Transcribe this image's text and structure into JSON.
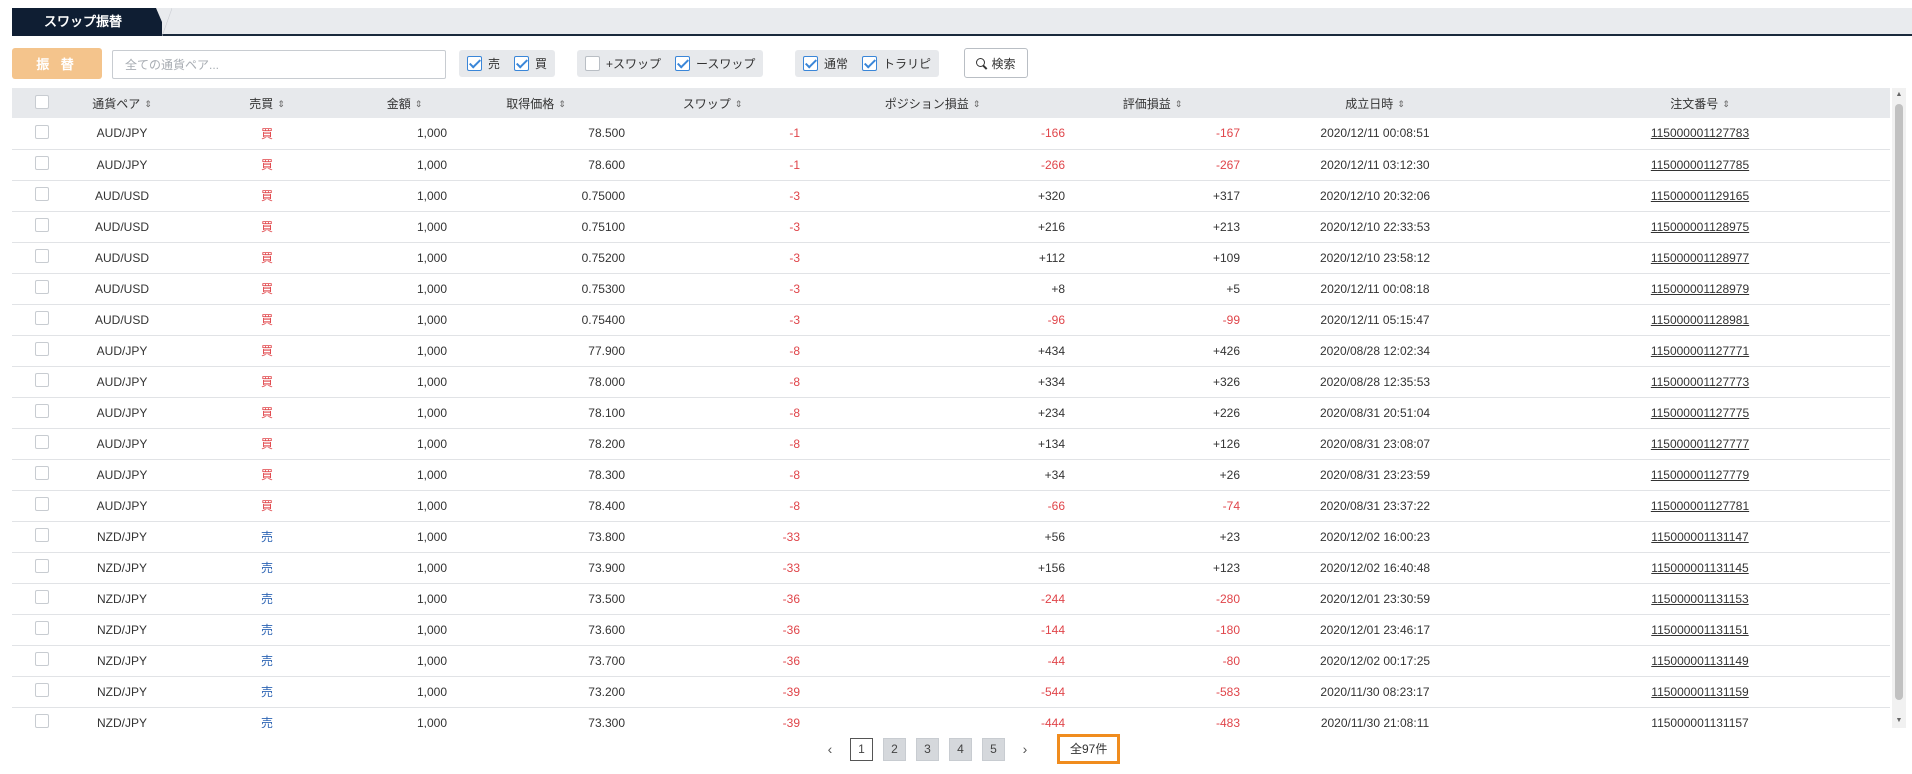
{
  "tab": {
    "label": "スワップ振替"
  },
  "toolbar": {
    "transfer_label": "振 替",
    "search_placeholder": "全ての通貨ペア...",
    "filters": {
      "sell": {
        "label": "売",
        "checked": true
      },
      "buy": {
        "label": "買",
        "checked": true
      },
      "plus_swap": {
        "label": "+スワップ",
        "checked": false
      },
      "minus_swap": {
        "label": "ースワップ",
        "checked": true
      },
      "normal": {
        "label": "通常",
        "checked": true
      },
      "torarepi": {
        "label": "トラリピ",
        "checked": true
      }
    },
    "search_label": "検索"
  },
  "table": {
    "headers": {
      "pair": "通貨ペア",
      "side": "売買",
      "amount": "金額",
      "price": "取得価格",
      "swap": "スワップ",
      "position_pl": "ポジション損益",
      "eval_pl": "評価損益",
      "date": "成立日時",
      "order": "注文番号"
    },
    "rows": [
      {
        "pair": "AUD/JPY",
        "side": "買",
        "amount": "1,000",
        "price": "78.500",
        "swap": "-1",
        "position_pl": "-166",
        "eval_pl": "-167",
        "date": "2020/12/11 00:08:51",
        "order": "115000001127783"
      },
      {
        "pair": "AUD/JPY",
        "side": "買",
        "amount": "1,000",
        "price": "78.600",
        "swap": "-1",
        "position_pl": "-266",
        "eval_pl": "-267",
        "date": "2020/12/11 03:12:30",
        "order": "115000001127785"
      },
      {
        "pair": "AUD/USD",
        "side": "買",
        "amount": "1,000",
        "price": "0.75000",
        "swap": "-3",
        "position_pl": "+320",
        "eval_pl": "+317",
        "date": "2020/12/10 20:32:06",
        "order": "115000001129165"
      },
      {
        "pair": "AUD/USD",
        "side": "買",
        "amount": "1,000",
        "price": "0.75100",
        "swap": "-3",
        "position_pl": "+216",
        "eval_pl": "+213",
        "date": "2020/12/10 22:33:53",
        "order": "115000001128975"
      },
      {
        "pair": "AUD/USD",
        "side": "買",
        "amount": "1,000",
        "price": "0.75200",
        "swap": "-3",
        "position_pl": "+112",
        "eval_pl": "+109",
        "date": "2020/12/10 23:58:12",
        "order": "115000001128977"
      },
      {
        "pair": "AUD/USD",
        "side": "買",
        "amount": "1,000",
        "price": "0.75300",
        "swap": "-3",
        "position_pl": "+8",
        "eval_pl": "+5",
        "date": "2020/12/11 00:08:18",
        "order": "115000001128979"
      },
      {
        "pair": "AUD/USD",
        "side": "買",
        "amount": "1,000",
        "price": "0.75400",
        "swap": "-3",
        "position_pl": "-96",
        "eval_pl": "-99",
        "date": "2020/12/11 05:15:47",
        "order": "115000001128981"
      },
      {
        "pair": "AUD/JPY",
        "side": "買",
        "amount": "1,000",
        "price": "77.900",
        "swap": "-8",
        "position_pl": "+434",
        "eval_pl": "+426",
        "date": "2020/08/28 12:02:34",
        "order": "115000001127771"
      },
      {
        "pair": "AUD/JPY",
        "side": "買",
        "amount": "1,000",
        "price": "78.000",
        "swap": "-8",
        "position_pl": "+334",
        "eval_pl": "+326",
        "date": "2020/08/28 12:35:53",
        "order": "115000001127773"
      },
      {
        "pair": "AUD/JPY",
        "side": "買",
        "amount": "1,000",
        "price": "78.100",
        "swap": "-8",
        "position_pl": "+234",
        "eval_pl": "+226",
        "date": "2020/08/31 20:51:04",
        "order": "115000001127775"
      },
      {
        "pair": "AUD/JPY",
        "side": "買",
        "amount": "1,000",
        "price": "78.200",
        "swap": "-8",
        "position_pl": "+134",
        "eval_pl": "+126",
        "date": "2020/08/31 23:08:07",
        "order": "115000001127777"
      },
      {
        "pair": "AUD/JPY",
        "side": "買",
        "amount": "1,000",
        "price": "78.300",
        "swap": "-8",
        "position_pl": "+34",
        "eval_pl": "+26",
        "date": "2020/08/31 23:23:59",
        "order": "115000001127779"
      },
      {
        "pair": "AUD/JPY",
        "side": "買",
        "amount": "1,000",
        "price": "78.400",
        "swap": "-8",
        "position_pl": "-66",
        "eval_pl": "-74",
        "date": "2020/08/31 23:37:22",
        "order": "115000001127781"
      },
      {
        "pair": "NZD/JPY",
        "side": "売",
        "amount": "1,000",
        "price": "73.800",
        "swap": "-33",
        "position_pl": "+56",
        "eval_pl": "+23",
        "date": "2020/12/02 16:00:23",
        "order": "115000001131147"
      },
      {
        "pair": "NZD/JPY",
        "side": "売",
        "amount": "1,000",
        "price": "73.900",
        "swap": "-33",
        "position_pl": "+156",
        "eval_pl": "+123",
        "date": "2020/12/02 16:40:48",
        "order": "115000001131145"
      },
      {
        "pair": "NZD/JPY",
        "side": "売",
        "amount": "1,000",
        "price": "73.500",
        "swap": "-36",
        "position_pl": "-244",
        "eval_pl": "-280",
        "date": "2020/12/01 23:30:59",
        "order": "115000001131153"
      },
      {
        "pair": "NZD/JPY",
        "side": "売",
        "amount": "1,000",
        "price": "73.600",
        "swap": "-36",
        "position_pl": "-144",
        "eval_pl": "-180",
        "date": "2020/12/01 23:46:17",
        "order": "115000001131151"
      },
      {
        "pair": "NZD/JPY",
        "side": "売",
        "amount": "1,000",
        "price": "73.700",
        "swap": "-36",
        "position_pl": "-44",
        "eval_pl": "-80",
        "date": "2020/12/02 00:17:25",
        "order": "115000001131149"
      },
      {
        "pair": "NZD/JPY",
        "side": "売",
        "amount": "1,000",
        "price": "73.200",
        "swap": "-39",
        "position_pl": "-544",
        "eval_pl": "-583",
        "date": "2020/11/30 08:23:17",
        "order": "115000001131159"
      },
      {
        "pair": "NZD/JPY",
        "side": "売",
        "amount": "1,000",
        "price": "73.300",
        "swap": "-39",
        "position_pl": "-444",
        "eval_pl": "-483",
        "date": "2020/11/30 21:08:11",
        "order": "115000001131157"
      }
    ]
  },
  "pagination": {
    "prev_icon": "chevron-left-icon",
    "pages": [
      "1",
      "2",
      "3",
      "4",
      "5"
    ],
    "current": "1",
    "next_icon": "chevron-right-icon",
    "total_label": "全97件"
  },
  "colors": {
    "buy": "#e0454a",
    "sell": "#2d64b4",
    "negative": "#e0454a",
    "accent": "#f4c48c",
    "highlight": "#f08c1e"
  }
}
